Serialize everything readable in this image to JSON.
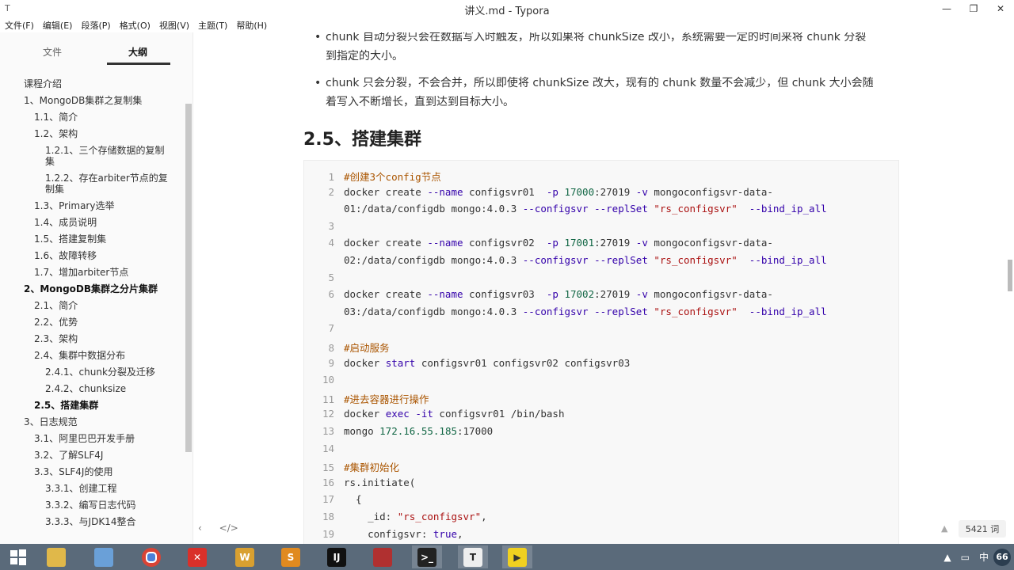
{
  "window": {
    "title": "讲义.md - Typora",
    "app_icon": "T",
    "minimize": "—",
    "maximize": "❐",
    "close": "✕"
  },
  "menu": [
    "文件(F)",
    "编辑(E)",
    "段落(P)",
    "格式(O)",
    "视图(V)",
    "主题(T)",
    "帮助(H)"
  ],
  "sidebar": {
    "tabs": {
      "files": "文件",
      "outline": "大纲"
    },
    "outline": [
      {
        "label": "课程介绍",
        "level": 1
      },
      {
        "label": "1、MongoDB集群之复制集",
        "level": 1
      },
      {
        "label": "1.1、简介",
        "level": 2
      },
      {
        "label": "1.2、架构",
        "level": 2
      },
      {
        "label": "1.2.1、三个存储数据的复制集",
        "level": 3
      },
      {
        "label": "1.2.2、存在arbiter节点的复制集",
        "level": 3
      },
      {
        "label": "1.3、Primary选举",
        "level": 2
      },
      {
        "label": "1.4、成员说明",
        "level": 2
      },
      {
        "label": "1.5、搭建复制集",
        "level": 2
      },
      {
        "label": "1.6、故障转移",
        "level": 2
      },
      {
        "label": "1.7、增加arbiter节点",
        "level": 2
      },
      {
        "label": "2、MongoDB集群之分片集群",
        "level": 1,
        "bold": true
      },
      {
        "label": "2.1、简介",
        "level": 2
      },
      {
        "label": "2.2、优势",
        "level": 2
      },
      {
        "label": "2.3、架构",
        "level": 2
      },
      {
        "label": "2.4、集群中数据分布",
        "level": 2
      },
      {
        "label": "2.4.1、chunk分裂及迁移",
        "level": 3
      },
      {
        "label": "2.4.2、chunksize",
        "level": 3
      },
      {
        "label": "2.5、搭建集群",
        "level": 2,
        "bold": true
      },
      {
        "label": "3、日志规范",
        "level": 1
      },
      {
        "label": "3.1、阿里巴巴开发手册",
        "level": 2
      },
      {
        "label": "3.2、了解SLF4J",
        "level": 2
      },
      {
        "label": "3.3、SLF4J的使用",
        "level": 2
      },
      {
        "label": "3.3.1、创建工程",
        "level": 3
      },
      {
        "label": "3.3.2、编写日志代码",
        "level": 3
      },
      {
        "label": "3.3.3、与JDK14整合",
        "level": 3
      }
    ]
  },
  "content": {
    "bullet1_line1": "chunk 自动分裂只会在数据写入时触发，所以如果将 chunkSize 改小，系统需要一定的时间来将 chunk 分裂",
    "bullet1_line2": "到指定的大小。",
    "bullet2_line1": "chunk 只会分裂，不会合并，所以即使将 chunkSize 改大，现有的 chunk 数量不会减少，但 chunk 大小会随",
    "bullet2_line2": "着写入不断增长，直到达到目标大小。",
    "heading": "2.5、搭建集群",
    "code": [
      {
        "n": "1",
        "t": "#创建3个config节点",
        "type": "comment"
      },
      {
        "n": "2",
        "t": "docker create --name configsvr01  -p 17000:27019 -v mongoconfigsvr-data-"
      },
      {
        "n": "",
        "t": "01:/data/configdb mongo:4.0.3 --configsvr --replSet \"rs_configsvr\"  --bind_ip_all"
      },
      {
        "n": "3",
        "t": ""
      },
      {
        "n": "4",
        "t": "docker create --name configsvr02  -p 17001:27019 -v mongoconfigsvr-data-"
      },
      {
        "n": "",
        "t": "02:/data/configdb mongo:4.0.3 --configsvr --replSet \"rs_configsvr\"  --bind_ip_all"
      },
      {
        "n": "5",
        "t": ""
      },
      {
        "n": "6",
        "t": "docker create --name configsvr03  -p 17002:27019 -v mongoconfigsvr-data-"
      },
      {
        "n": "",
        "t": "03:/data/configdb mongo:4.0.3 --configsvr --replSet \"rs_configsvr\"  --bind_ip_all"
      },
      {
        "n": "7",
        "t": ""
      },
      {
        "n": "8",
        "t": "#启动服务",
        "type": "comment"
      },
      {
        "n": "9",
        "t": "docker start configsvr01 configsvr02 configsvr03"
      },
      {
        "n": "10",
        "t": ""
      },
      {
        "n": "11",
        "t": "#进去容器进行操作",
        "type": "comment"
      },
      {
        "n": "12",
        "t": "docker exec -it configsvr01 /bin/bash"
      },
      {
        "n": "13",
        "t": "mongo 172.16.55.185:17000"
      },
      {
        "n": "14",
        "t": ""
      },
      {
        "n": "15",
        "t": "#集群初始化",
        "type": "comment"
      },
      {
        "n": "16",
        "t": "rs.initiate("
      },
      {
        "n": "17",
        "t": "  {"
      },
      {
        "n": "18",
        "t": "    _id: \"rs_configsvr\","
      },
      {
        "n": "19",
        "t": "    configsvr: true,"
      }
    ]
  },
  "status": {
    "left_arrow": "‹",
    "source_toggle": "</>",
    "up_arrow": "▲",
    "word_count": "5421 词"
  },
  "taskbar": {
    "apps": [
      "start-icon",
      "file-explorer-icon",
      "paint-icon",
      "chrome-icon",
      "xmind-icon",
      "wps-icon",
      "sublime-icon",
      "intellij-icon",
      "notepad-icon",
      "terminal-icon",
      "typora-icon",
      "player-icon"
    ],
    "tray_ime": "中",
    "tray_badge": "66"
  }
}
